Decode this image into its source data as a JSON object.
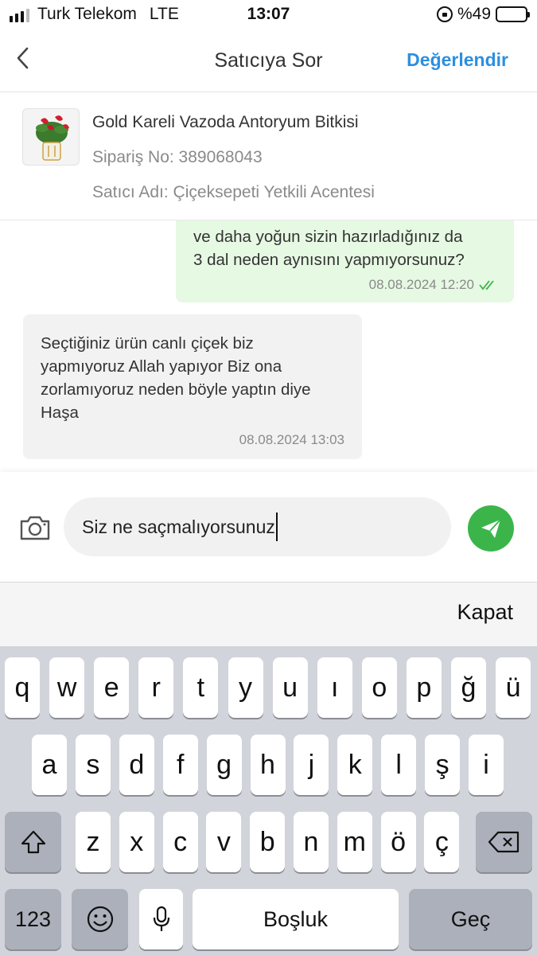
{
  "status_bar": {
    "carrier": "Turk Telekom",
    "network": "LTE",
    "time": "13:07",
    "battery": "%49",
    "battery_level": 0.49
  },
  "nav": {
    "title": "Satıcıya Sor",
    "action": "Değerlendir",
    "back_icon": "chevron-left-icon"
  },
  "product": {
    "name": "Gold Kareli Vazoda Antoryum Bitkisi",
    "order": "Sipariş No: 389068043",
    "seller": "Satıcı Adı: Çiçeksepeti Yetkili Acentesi"
  },
  "messages": [
    {
      "direction": "outgoing",
      "text": "ve daha yoğun sizin hazırladığınız da\n3 dal neden aynısını yapmıyorsunuz?",
      "timestamp": "08.08.2024 12:20",
      "status_icon": "double-check-icon"
    },
    {
      "direction": "incoming",
      "text": "Seçtiğiniz ürün canlı çiçek biz\nyapmıyoruz Allah yapıyor Biz ona\nzorlamıyoruz neden böyle yaptın diye\nHaşa",
      "timestamp": "08.08.2024 13:03"
    }
  ],
  "composer": {
    "value": "Siz ne saçmalıyorsunuz",
    "camera_icon": "camera-icon",
    "send_icon": "send-icon"
  },
  "accessory": {
    "close_label": "Kapat"
  },
  "keyboard": {
    "row1": [
      "q",
      "w",
      "e",
      "r",
      "t",
      "y",
      "u",
      "ı",
      "o",
      "p",
      "ğ",
      "ü"
    ],
    "row2": [
      "a",
      "s",
      "d",
      "f",
      "g",
      "h",
      "j",
      "k",
      "l",
      "ş",
      "i"
    ],
    "row3": [
      "z",
      "x",
      "c",
      "v",
      "b",
      "n",
      "m",
      "ö",
      "ç"
    ],
    "numbers_label": "123",
    "space_label": "Boşluk",
    "return_label": "Geç",
    "shift_icon": "shift-icon",
    "delete_icon": "backspace-icon",
    "emoji_icon": "emoji-icon",
    "mic_icon": "microphone-icon"
  },
  "colors": {
    "accent_blue": "#2c8fe0",
    "send_green": "#3bb54a",
    "outgoing_bubble": "#e6f9e3",
    "incoming_bubble": "#f2f2f2",
    "keyboard_bg": "#d1d4da"
  }
}
